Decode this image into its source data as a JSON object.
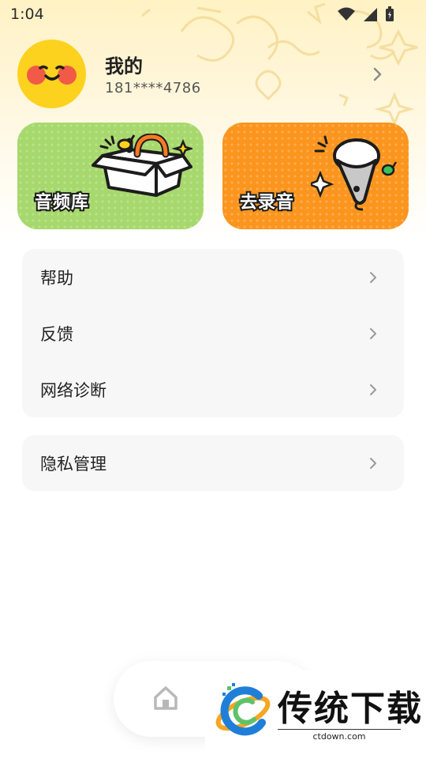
{
  "status_bar": {
    "time": "1:04"
  },
  "profile": {
    "name": "我的",
    "phone": "181****4786"
  },
  "cards": [
    {
      "label": "音频库",
      "icon": "box-icon",
      "color": "#a7d86d"
    },
    {
      "label": "去录音",
      "icon": "microphone-icon",
      "color": "#fb951e"
    }
  ],
  "menu": {
    "group1": [
      {
        "label": "帮助"
      },
      {
        "label": "反馈"
      },
      {
        "label": "网络诊断"
      }
    ],
    "group2": [
      {
        "label": "隐私管理"
      }
    ]
  },
  "tabbar": {
    "home_icon": "home-icon"
  },
  "watermark": {
    "title": "传统下载",
    "url": "ctdown.com"
  }
}
